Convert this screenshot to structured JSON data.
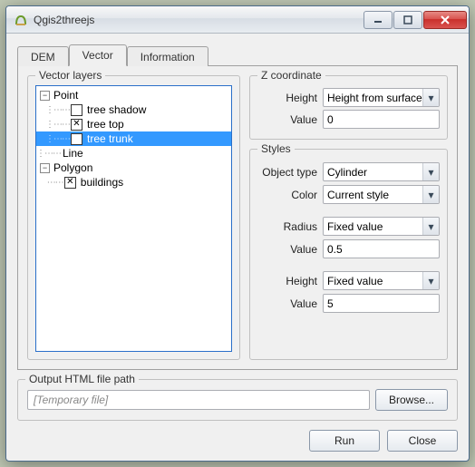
{
  "window": {
    "title": "Qgis2threejs"
  },
  "tabs": {
    "dem": "DEM",
    "vector": "Vector",
    "information": "Information",
    "active": "vector"
  },
  "layers": {
    "legend": "Vector layers",
    "groups": {
      "point": {
        "label": "Point",
        "items": [
          {
            "label": "tree shadow",
            "checked": false,
            "selected": false
          },
          {
            "label": "tree top",
            "checked": true,
            "selected": false
          },
          {
            "label": "tree trunk",
            "checked": true,
            "selected": true
          }
        ]
      },
      "line": {
        "label": "Line"
      },
      "polygon": {
        "label": "Polygon",
        "items": [
          {
            "label": "buildings",
            "checked": true,
            "selected": false
          }
        ]
      }
    }
  },
  "z": {
    "legend": "Z coordinate",
    "height_label": "Height",
    "height_value": "Height from surface",
    "value_label": "Value",
    "value_value": "0"
  },
  "styles": {
    "legend": "Styles",
    "object_type_label": "Object type",
    "object_type_value": "Cylinder",
    "color_label": "Color",
    "color_value": "Current style",
    "radius_mode_label": "Radius",
    "radius_mode_value": "Fixed value",
    "radius_value_label": "Value",
    "radius_value_value": "0.5",
    "height_mode_label": "Height",
    "height_mode_value": "Fixed value",
    "height_value_label": "Value",
    "height_value_value": "5"
  },
  "output": {
    "legend": "Output HTML file path",
    "placeholder": "[Temporary file]",
    "browse": "Browse..."
  },
  "buttons": {
    "run": "Run",
    "close": "Close"
  }
}
